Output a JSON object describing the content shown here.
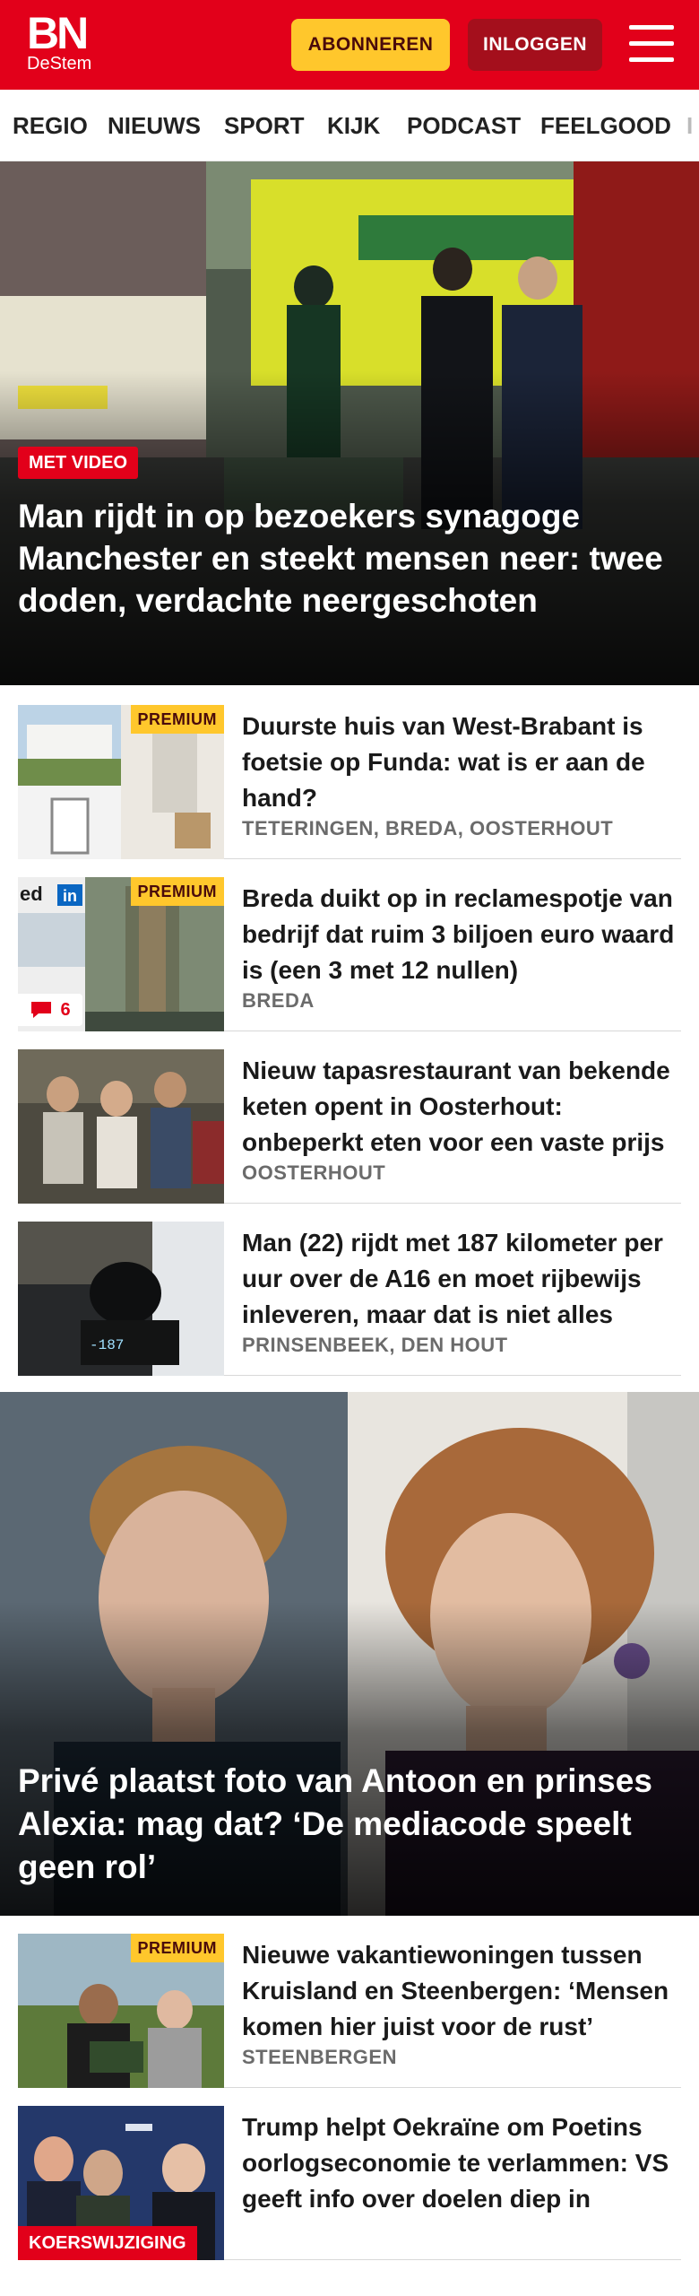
{
  "brand": {
    "logo_main": "BN",
    "logo_sub": "DeStem",
    "primary_color": "#e2001a",
    "accent_color": "#ffc72c"
  },
  "header": {
    "subscribe_label": "ABONNEREN",
    "login_label": "INLOGGEN",
    "menu_icon": "hamburger-menu-icon"
  },
  "nav": {
    "items": [
      "REGIO",
      "NIEUWS",
      "SPORT",
      "KIJK",
      "PODCAST",
      "FEELGOOD",
      "I"
    ]
  },
  "hero": {
    "badge": "MET VIDEO",
    "title": "Man rijdt in op bezoekers synagoge Manchester en steekt mensen neer: twee doden, verdachte neergeschoten"
  },
  "articles": [
    {
      "premium": "PREMIUM",
      "title": "Duurste huis van West-Brabant is foetsie op Funda: wat is er aan de hand?",
      "meta": "TETERINGEN, BREDA, OOSTERHOUT"
    },
    {
      "premium": "PREMIUM",
      "comments": "6",
      "title": "Breda duikt op in reclamespotje van bedrijf dat ruim 3 biljoen euro waard is (een 3 met 12 nullen)",
      "meta": "BREDA"
    },
    {
      "title": "Nieuw tapasrestaurant van bekende keten opent in Oosterhout: onbeperkt eten voor een vaste prijs",
      "meta": "OOSTERHOUT"
    },
    {
      "title": "Man (22) rijdt met 187 kilometer per uur over de A16 en moet rijbewijs inleveren, maar dat is niet alles",
      "meta": "PRINSENBEEK, DEN HOUT"
    }
  ],
  "feature": {
    "title": "Privé plaatst foto van Antoon en prinses Alexia: mag dat? ‘De mediacode speelt geen rol’"
  },
  "articles_bottom": [
    {
      "premium": "PREMIUM",
      "title": "Nieuwe vakantiewoningen tussen Kruisland en Steenbergen: ‘Mensen komen hier juist voor de rust’",
      "meta": "STEENBERGEN"
    },
    {
      "badge": "KOERSWIJZIGING",
      "title": "Trump helpt Oekraïne om Poetins oorlogseconomie te verlammen: VS geeft info over doelen diep in Rusland"
    }
  ]
}
